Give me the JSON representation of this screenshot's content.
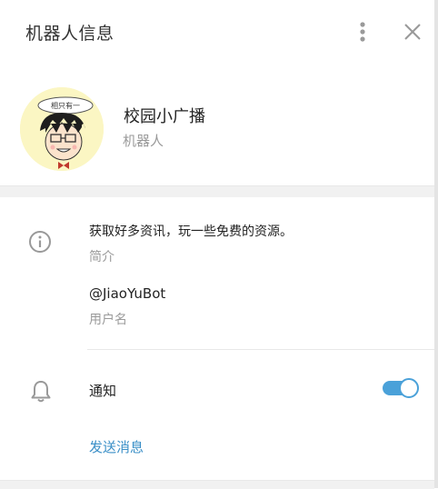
{
  "header": {
    "title": "机器人信息",
    "icons": [
      "more-vertical-icon",
      "close-icon"
    ]
  },
  "profile": {
    "name": "校园小广播",
    "type": "机器人",
    "avatar_bubble_text": "相只有一"
  },
  "info": {
    "description": "获取好多资讯，玩一些免费的资源。",
    "description_label": "简介",
    "username": "@JiaoYuBot",
    "username_label": "用户名"
  },
  "notifications": {
    "label": "通知",
    "enabled": true
  },
  "actions": {
    "send_message": "发送消息"
  },
  "colors": {
    "accent": "#4aa1d9",
    "link": "#3a8fc7",
    "secondary_text": "#9a9a9a",
    "avatar_bg": "#fbf6c3"
  }
}
